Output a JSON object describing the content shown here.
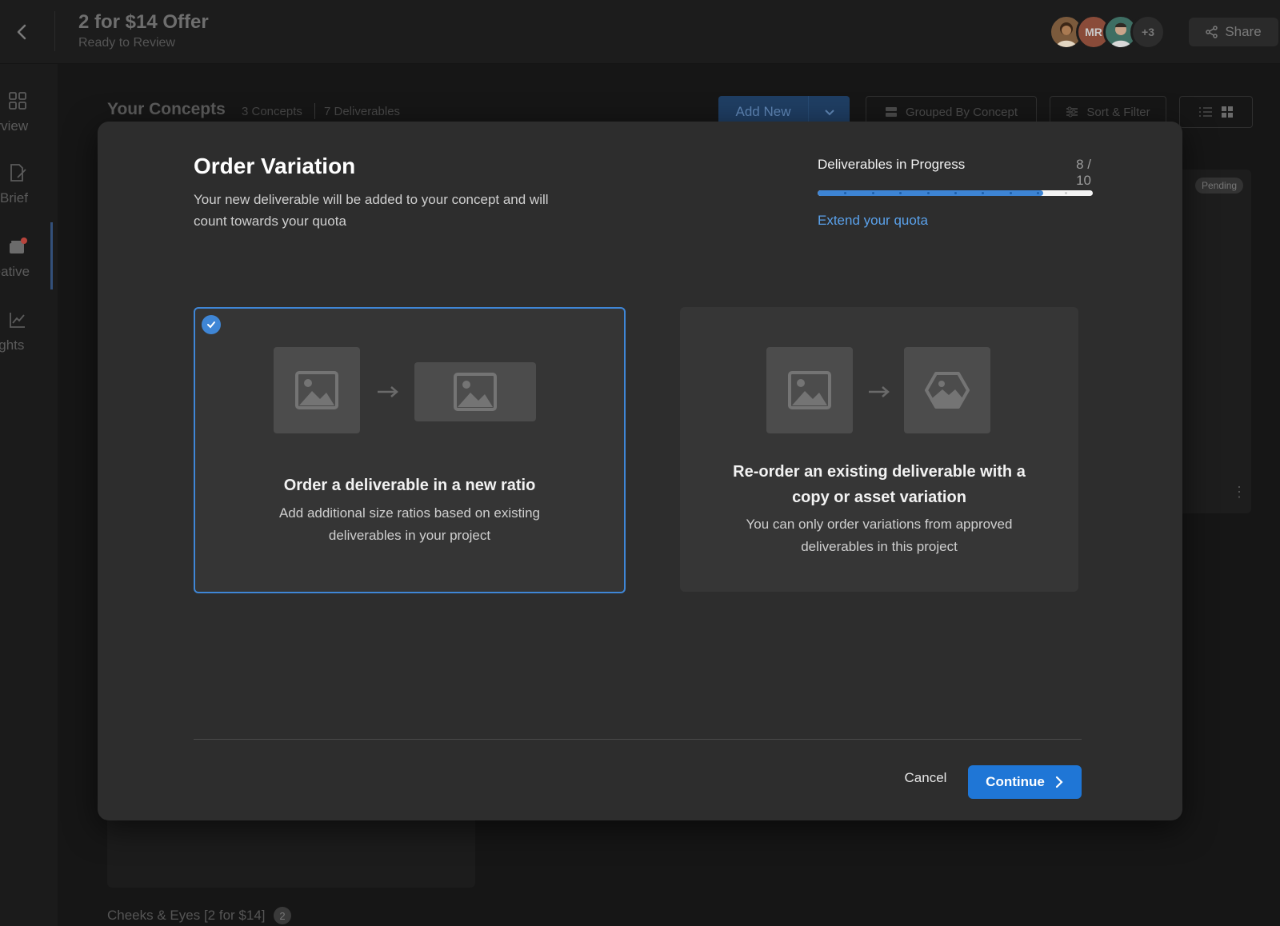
{
  "header": {
    "project_title": "2 for $14 Offer",
    "project_status": "Ready to Review",
    "avatars": [
      {
        "initials": "",
        "color": "#7b5a3c"
      },
      {
        "initials": "MR",
        "color": "#8a4b39"
      },
      {
        "initials": "",
        "color": "#3e6e63"
      }
    ],
    "avatar_overflow": "+3",
    "share_label": "Share"
  },
  "rail": {
    "items": [
      {
        "label": "Overview",
        "visible_label": "erview",
        "icon": "grid-icon"
      },
      {
        "label": "Brief",
        "visible_label": "Brief",
        "icon": "document-edit-icon"
      },
      {
        "label": "Creative",
        "visible_label": "reative",
        "icon": "layers-icon",
        "active": true
      },
      {
        "label": "Insights",
        "visible_label": "sights",
        "icon": "chart-line-icon"
      }
    ]
  },
  "concepts": {
    "title": "Your Concepts",
    "concept_count": "3 Concepts",
    "deliverable_count": "7 Deliverables",
    "add_new_label": "Add New",
    "grouped_label": "Grouped By Concept",
    "sort_filter_label": "Sort & Filter",
    "pending_badge": "Pending",
    "group_title": "Cheeks & Eyes [2 for $14]",
    "group_count": "2"
  },
  "modal": {
    "title": "Order Variation",
    "description": "Your new deliverable will be added to your concept and will count towards your quota",
    "progress": {
      "label": "Deliverables in Progress",
      "count_text": "8 / 10",
      "completed": 8,
      "total": 10,
      "fill_fraction": 0.82
    },
    "extend_link": "Extend your quota",
    "options": [
      {
        "title": "Order a deliverable in a new ratio",
        "description": "Add additional size ratios based on existing deliverables in your project",
        "selected": true
      },
      {
        "title": "Re-order an existing deliverable with a copy or asset variation",
        "description": "You can only order variations from approved deliverables in this project",
        "selected": false
      }
    ],
    "cancel_label": "Cancel",
    "continue_label": "Continue"
  },
  "colors": {
    "accent": "#1f76d6",
    "link": "#5aa1ea",
    "modal_bg": "#2d2d2d",
    "selected_border": "#3f86d6"
  }
}
